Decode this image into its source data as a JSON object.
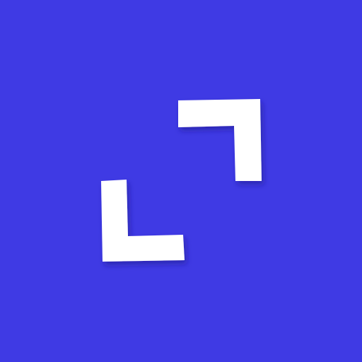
{
  "icon": {
    "name": "expand-icon",
    "background_color": "#3f3ae4",
    "glyph_color": "#ffffff",
    "shadow_color": "#1e1a8c"
  }
}
